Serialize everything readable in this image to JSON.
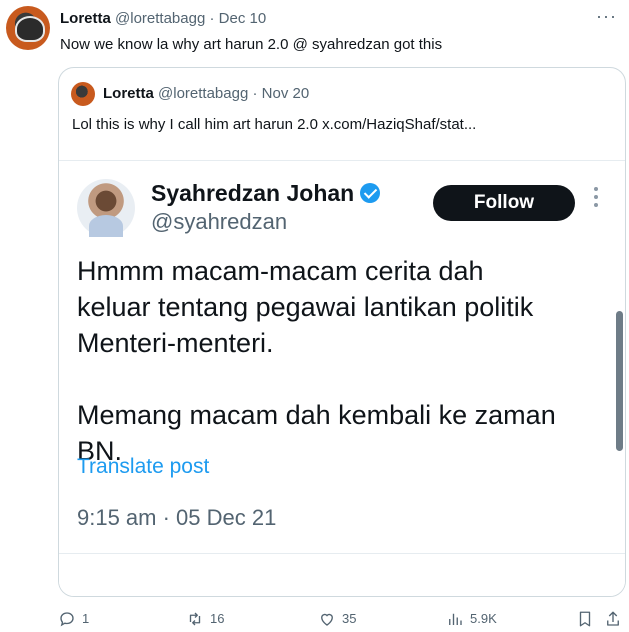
{
  "tweet": {
    "author_name": "Loretta",
    "author_handle": "@lorettabagg",
    "separator": "·",
    "date": "Dec 10",
    "text": "Now we know la why art harun 2.0 @ syahredzan got this",
    "more_icon": "ellipsis-icon"
  },
  "quote": {
    "author_name": "Loretta",
    "author_handle": "@lorettabagg",
    "separator": "·",
    "date": "Nov 20",
    "text": "Lol this is why I call him art harun 2.0  x.com/HaziqShaf/stat..."
  },
  "embed": {
    "name": "Syahredzan Johan",
    "handle": "@syahredzan",
    "follow_label": "Follow",
    "body": "Hmmm macam-macam cerita dah\nkeluar tentang pegawai lantikan politik\nMenteri-menteri.\n\nMemang macam dah kembali ke zaman\nBN.",
    "translate_label": "Translate post",
    "timestamp": "9:15 am · 05 Dec 21"
  },
  "actions": {
    "reply_count": "1",
    "retweet_count": "16",
    "like_count": "35",
    "views_count": "5.9K"
  },
  "colors": {
    "accent": "#1d9bf0",
    "text_primary": "#0f1419",
    "text_secondary": "#536471",
    "border": "#cfd9de"
  }
}
